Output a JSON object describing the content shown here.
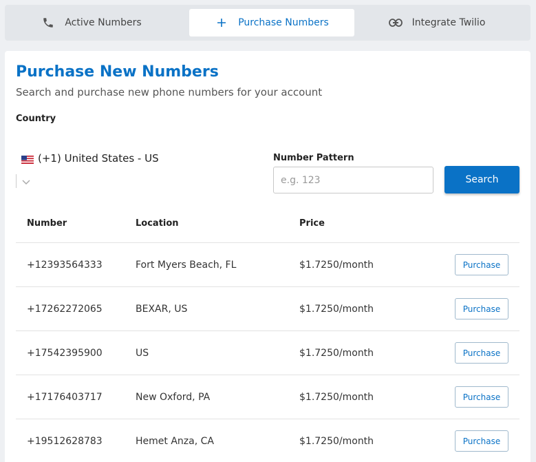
{
  "tabs": [
    {
      "label": "Active Numbers",
      "icon": "phone-icon"
    },
    {
      "label": "Purchase Numbers",
      "icon": "plus-icon",
      "active": true
    },
    {
      "label": "Integrate Twilio",
      "icon": "link-icon"
    }
  ],
  "header": {
    "title": "Purchase New Numbers",
    "subtitle": "Search and purchase new phone numbers for your account"
  },
  "form": {
    "country_label": "Country",
    "country_value": "(+1) United States - US",
    "pattern_label": "Number Pattern",
    "pattern_placeholder": "e.g. 123",
    "pattern_value": "",
    "search_label": "Search"
  },
  "table": {
    "headers": {
      "number": "Number",
      "location": "Location",
      "price": "Price"
    },
    "rows": [
      {
        "number": "+12393564333",
        "location": "Fort Myers Beach, FL",
        "price": "$1.7250/month",
        "action": "Purchase"
      },
      {
        "number": "+17262272065",
        "location": "BEXAR, US",
        "price": "$1.7250/month",
        "action": "Purchase"
      },
      {
        "number": "+17542395900",
        "location": "US",
        "price": "$1.7250/month",
        "action": "Purchase"
      },
      {
        "number": "+17176403717",
        "location": "New Oxford, PA",
        "price": "$1.7250/month",
        "action": "Purchase"
      },
      {
        "number": "+19512628783",
        "location": "Hemet Anza, CA",
        "price": "$1.7250/month",
        "action": "Purchase"
      }
    ]
  },
  "colors": {
    "accent": "#0a72c6",
    "tab_bar": "#e3e6ea",
    "background": "#eef0f3"
  }
}
